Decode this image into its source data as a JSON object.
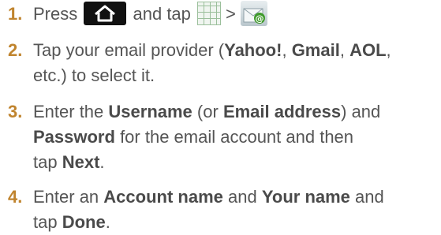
{
  "steps": [
    {
      "number": "1.",
      "parts": {
        "t1": "Press",
        "t2": "and tap",
        "t3": ">"
      },
      "icons": [
        "home-icon",
        "apps-grid-icon",
        "email-app-icon"
      ]
    },
    {
      "number": "2.",
      "parts": {
        "t1": "Tap your email provider (",
        "b1": "Yahoo!",
        "t2": ", ",
        "b2": "Gmail",
        "t3": ", ",
        "b3": "AOL",
        "t4": ",",
        "t5": "etc.) to select it."
      }
    },
    {
      "number": "3.",
      "parts": {
        "t1": "Enter the",
        "b1": "Username",
        "t2": "(or",
        "b2": "Email address",
        "t3": ") and",
        "b3": "Password",
        "t4": "for the email account and then",
        "t5": "tap",
        "b4": "Next",
        "t6": "."
      }
    },
    {
      "number": "4.",
      "parts": {
        "t1": "Enter an",
        "b1": "Account name",
        "t2": "and",
        "b2": "Your name",
        "t3": "and",
        "t4": "tap",
        "b3": "Done",
        "t5": "."
      }
    }
  ],
  "colors": {
    "step_number": "#c0842e",
    "text": "#555555",
    "bold_text": "#4a4a4a"
  }
}
